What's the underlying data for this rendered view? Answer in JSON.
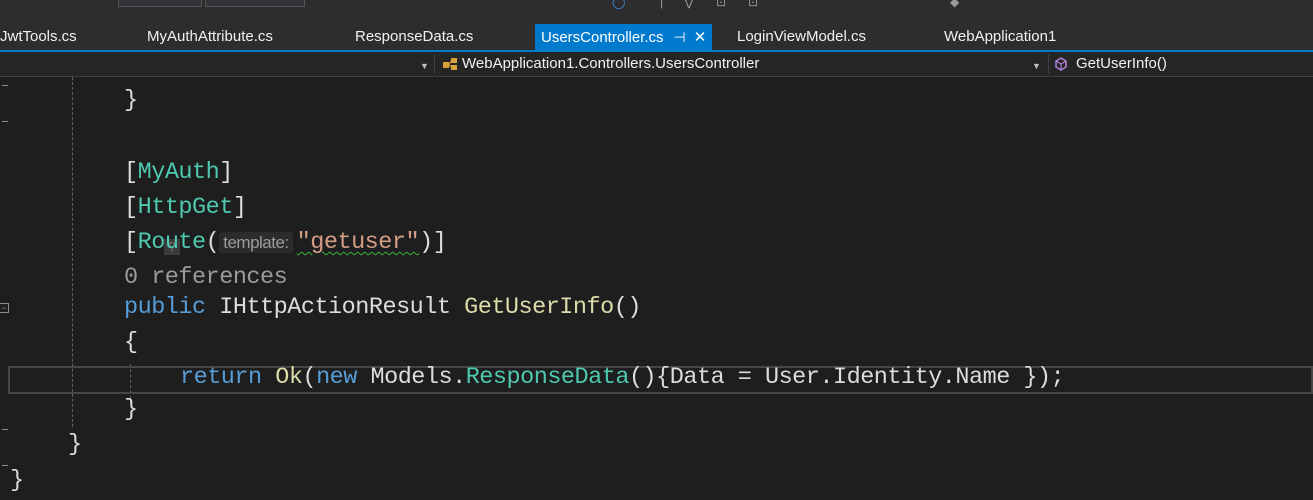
{
  "tabs": [
    {
      "label": "JwtTools.cs"
    },
    {
      "label": "MyAuthAttribute.cs"
    },
    {
      "label": "ResponseData.cs"
    },
    {
      "label": "UsersController.cs",
      "active": true
    },
    {
      "label": "LoginViewModel.cs"
    },
    {
      "label": "WebApplication1"
    }
  ],
  "navbar": {
    "class_path": "WebApplication1.Controllers.UsersController",
    "member": "GetUserInfo()"
  },
  "code": {
    "line_brace1": "}",
    "attr1": "MyAuth",
    "attr2": "HttpGet",
    "attr3_name": "Route",
    "param_hint": "template:",
    "route_value": "\"getuser\"",
    "references": "0 references",
    "kw_public": "public",
    "return_type": "IHttpActionResult",
    "method_name": "GetUserInfo",
    "open_brace": "{",
    "kw_return": "return",
    "ok_call": "Ok",
    "kw_new": "new",
    "models_ns": "Models.",
    "response_type": "ResponseData",
    "init_expr": "{Data = User.Identity.Name });",
    "close_brace_method": "}",
    "close_brace_class": "}",
    "close_brace_ns": "}"
  },
  "colors": {
    "keyword": "#569cd6",
    "type": "#4ec9b0",
    "string": "#d69d85",
    "tab_active": "#007acc"
  },
  "icons": [
    "pin-icon",
    "close-icon",
    "class-icon",
    "method-icon",
    "dropdown-arrow-icon",
    "fold-icon"
  ]
}
